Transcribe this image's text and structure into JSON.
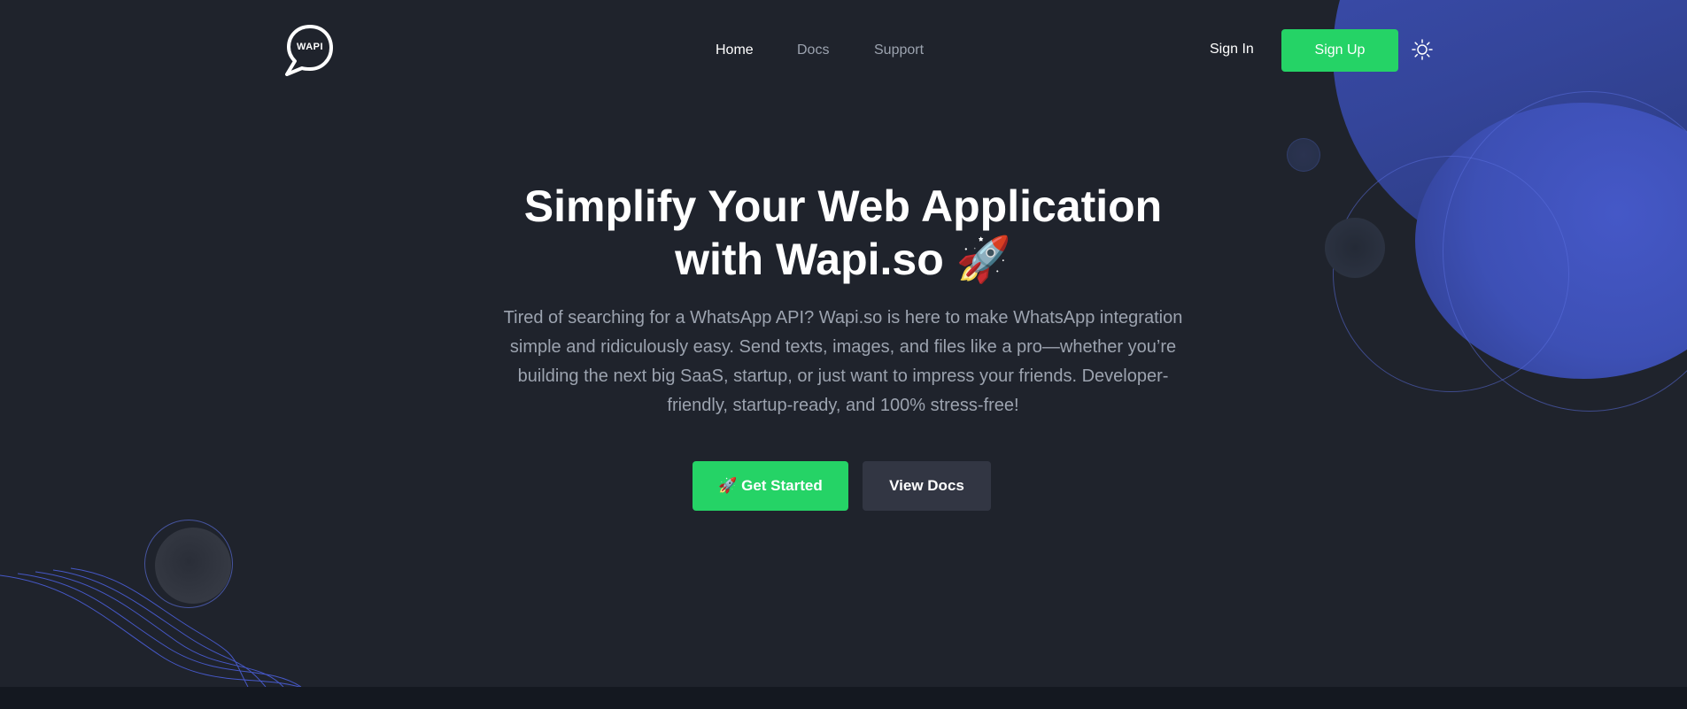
{
  "brand": {
    "logo_text": "WAPI",
    "accent_color": "#25d366",
    "background_color": "#1f232c",
    "secondary_accent": "#3d50b5"
  },
  "nav": {
    "links": [
      {
        "label": "Home",
        "active": true
      },
      {
        "label": "Docs",
        "active": false
      },
      {
        "label": "Support",
        "active": false
      }
    ],
    "sign_in_label": "Sign In",
    "sign_up_label": "Sign Up",
    "theme_toggle_icon": "sun-icon"
  },
  "hero": {
    "title_line1": "Simplify Your Web Application",
    "title_line2": "with Wapi.so 🚀",
    "description": "Tired of searching for a WhatsApp API? Wapi.so is here to make WhatsApp integration simple and ridiculously easy. Send texts, images, and files like a pro—whether you’re building the next big SaaS, startup, or just want to impress your friends. Developer-friendly, startup-ready, and 100% stress-free!",
    "primary_button_label": "🚀 Get Started",
    "secondary_button_label": "View Docs"
  }
}
